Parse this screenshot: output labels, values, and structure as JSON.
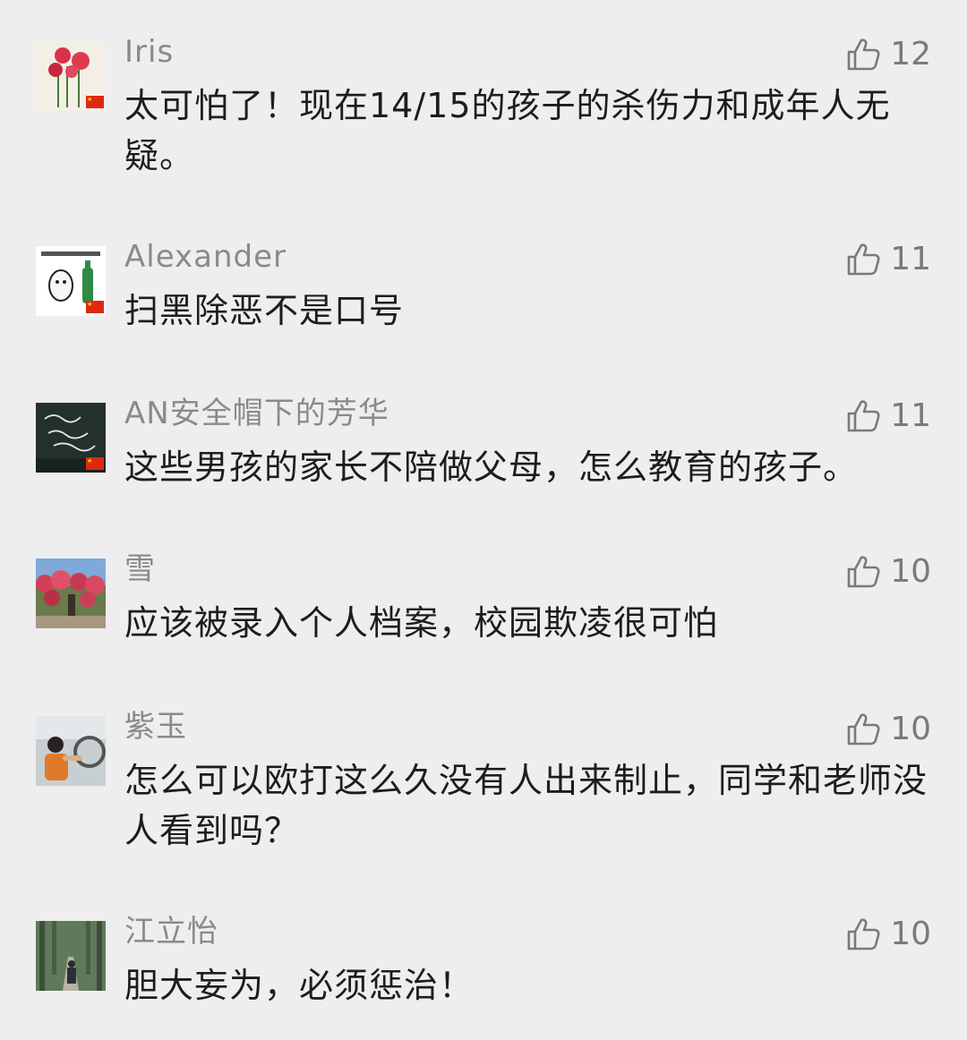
{
  "comments": [
    {
      "username": "Iris",
      "text": "太可怕了！现在14/15的孩子的杀伤力和成年人无疑。",
      "likes": "12",
      "avatar": "carnation-flowers",
      "flag": true
    },
    {
      "username": "Alexander",
      "text": "扫黑除恶不是口号",
      "likes": "11",
      "avatar": "meme-drink",
      "flag": true
    },
    {
      "username": "AN安全帽下的芳华",
      "text": "这些男孩的家长不陪做父母，怎么教育的孩子。",
      "likes": "11",
      "avatar": "chalkboard-writing",
      "flag": true
    },
    {
      "username": "雪",
      "text": "应该被录入个人档案，校园欺凌很可怕",
      "likes": "10",
      "avatar": "flower-bushes",
      "flag": false
    },
    {
      "username": "紫玉",
      "text": "怎么可以欧打这么久没有人出来制止，同学和老师没人看到吗？",
      "likes": "10",
      "avatar": "person-driving",
      "flag": false
    },
    {
      "username": "江立怡",
      "text": "胆大妄为，必须惩治！",
      "likes": "10",
      "avatar": "forest-path",
      "flag": false
    }
  ],
  "theme": {
    "background": "#eeeeee",
    "username_color": "#8a8a8a",
    "text_color": "#1d1d1d",
    "like_color": "#7a7a7a",
    "flag_red": "#de2910"
  }
}
